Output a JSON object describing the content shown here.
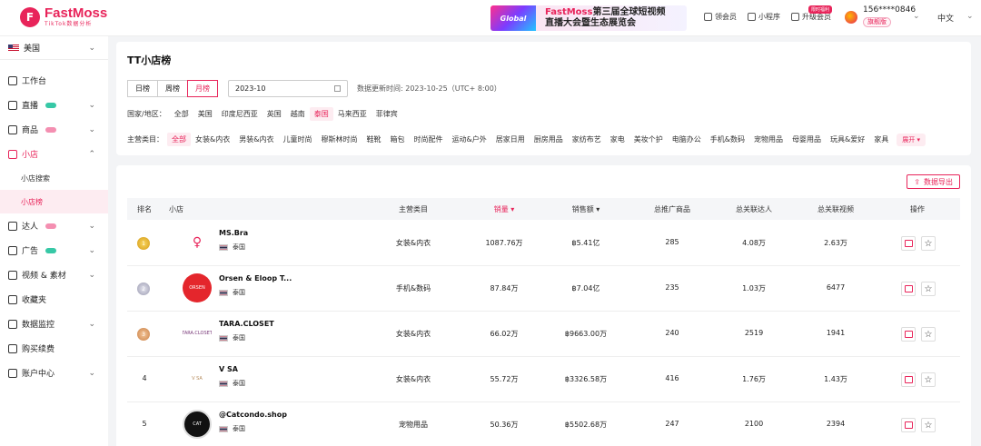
{
  "brand": {
    "name": "FastMoss",
    "sub": "TikTok数据分析",
    "mark": "F"
  },
  "banner": {
    "img_text": "Global",
    "brand": "FastMoss",
    "line1_rest": "第三届全球短视频",
    "line2": "直播大会暨生态展览会"
  },
  "top_links": [
    "领会员",
    "小程序",
    "升级会员"
  ],
  "upgrade_tag": "限时福利",
  "user": {
    "name": "156****0846",
    "plan": "旗舰版"
  },
  "language": "中文",
  "sidebar": {
    "country": "美国",
    "items": [
      {
        "label": "工作台"
      },
      {
        "label": "直播",
        "badge": "#37c8a6"
      },
      {
        "label": "商品",
        "badge": "#f48fb1"
      },
      {
        "label": "小店",
        "active": true
      },
      {
        "label": "达人",
        "badge": "#f48fb1"
      },
      {
        "label": "广告",
        "badge": "#37c8a6"
      },
      {
        "label": "视频 & 素材"
      },
      {
        "label": "收藏夹"
      },
      {
        "label": "数据监控"
      },
      {
        "label": "购买续费"
      },
      {
        "label": "账户中心"
      }
    ],
    "sub_items": [
      "小店搜索",
      "小店榜"
    ]
  },
  "page_title": "TT小店榜",
  "period_tabs": [
    "日榜",
    "周榜",
    "月榜"
  ],
  "active_period": "月榜",
  "date_value": "2023-10",
  "update_time": "数据更新时间:  2023-10-25（UTC+ 8:00）",
  "country_filter": {
    "label": "国家/地区：",
    "options": [
      "全部",
      "美国",
      "印度尼西亚",
      "英国",
      "越南",
      "泰国",
      "马来西亚",
      "菲律宾"
    ],
    "active": "泰国"
  },
  "category_filter": {
    "label": "主营类目：",
    "options": [
      "全部",
      "女装&内衣",
      "男装&内衣",
      "儿童时尚",
      "穆斯林时尚",
      "鞋靴",
      "箱包",
      "时尚配件",
      "运动&户外",
      "居家日用",
      "厨房用品",
      "家纺布艺",
      "家电",
      "美妆个护",
      "电脑办公",
      "手机&数码",
      "宠物用品",
      "母婴用品",
      "玩具&爱好",
      "家具"
    ],
    "active": "全部",
    "expand": "展开 ▾"
  },
  "export_label": "数据导出",
  "table": {
    "headers": [
      "排名",
      "小店",
      "主营类目",
      "销量 ▾",
      "销售额 ▾",
      "总推广商品",
      "总关联达人",
      "总关联视频",
      "操作"
    ],
    "rows": [
      {
        "rank": "1",
        "name": "MS.Bra",
        "country": "泰国",
        "category": "女装&内衣",
        "sales": "1087.76万",
        "revenue": "฿5.41亿",
        "products": "285",
        "creators": "4.08万",
        "videos": "2.63万",
        "logo_text": "♀"
      },
      {
        "rank": "2",
        "name": "Orsen & Eloop T...",
        "country": "泰国",
        "category": "手机&数码",
        "sales": "87.84万",
        "revenue": "฿7.04亿",
        "products": "235",
        "creators": "1.03万",
        "videos": "6477",
        "logo_text": "ORSEN"
      },
      {
        "rank": "3",
        "name": "TARA.CLOSET",
        "country": "泰国",
        "category": "女装&内衣",
        "sales": "66.02万",
        "revenue": "฿9663.00万",
        "products": "240",
        "creators": "2519",
        "videos": "1941",
        "logo_text": "TARA.CLOSET"
      },
      {
        "rank": "4",
        "name": "V SA",
        "country": "泰国",
        "category": "女装&内衣",
        "sales": "55.72万",
        "revenue": "฿3326.58万",
        "products": "416",
        "creators": "1.76万",
        "videos": "1.43万",
        "logo_text": "V SA"
      },
      {
        "rank": "5",
        "name": "@Catcondo.shop",
        "country": "泰国",
        "category": "宠物用品",
        "sales": "50.36万",
        "revenue": "฿5502.68万",
        "products": "247",
        "creators": "2100",
        "videos": "2394",
        "logo_text": "CAT"
      }
    ]
  }
}
